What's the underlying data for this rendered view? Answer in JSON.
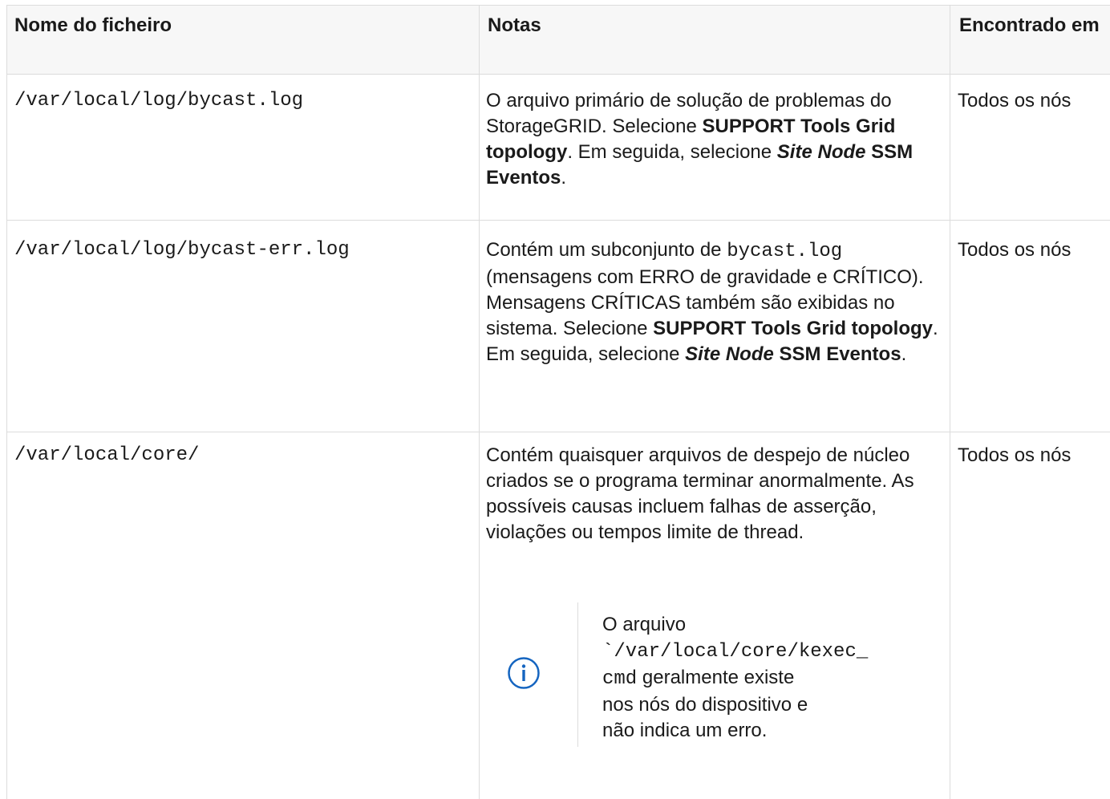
{
  "headers": {
    "filename": "Nome do ficheiro",
    "notes": "Notas",
    "found_in": "Encontrado em"
  },
  "rows": [
    {
      "filename": "/var/local/log/bycast.log",
      "notes": {
        "t1": "O arquivo primário de solução de problemas do StorageGRID. Selecione ",
        "b1": "SUPPORT Tools Grid topology",
        "t2": ". Em seguida, selecione ",
        "i1": "Site Node",
        "b2": " SSM Eventos",
        "t3": "."
      },
      "found_in": "Todos os nós"
    },
    {
      "filename": "/var/local/log/bycast-err.log",
      "notes": {
        "t1": "Contém um subconjunto de ",
        "code1": "bycast.log",
        "t2": " (mensagens com ERRO de gravidade e CRÍTICO). Mensagens CRÍTICAS também são exibidas no sistema. Selecione ",
        "b1": "SUPPORT Tools Grid topology",
        "t3": ". Em seguida, selecione ",
        "i1": "Site Node",
        "b2": " SSM Eventos",
        "t4": "."
      },
      "found_in": "Todos os nós"
    },
    {
      "filename": "/var/local/core/",
      "notes": {
        "t1": "Contém quaisquer arquivos de despejo de núcleo criados se o programa terminar anormalmente. As possíveis causas incluem falhas de asserção, violações ou tempos limite de thread."
      },
      "found_in": "Todos os nós",
      "admonition": {
        "icon": "info-circle-icon",
        "t1": "O arquivo ",
        "code1": "`/var/local/core/kexec_",
        "code2": "cmd",
        "t2": " geralmente existe nos nós do dispositivo e não indica um erro."
      }
    }
  ],
  "colors": {
    "border": "#dcdcdc",
    "header_bg": "#f7f7f7",
    "info_icon": "#1565c0"
  }
}
